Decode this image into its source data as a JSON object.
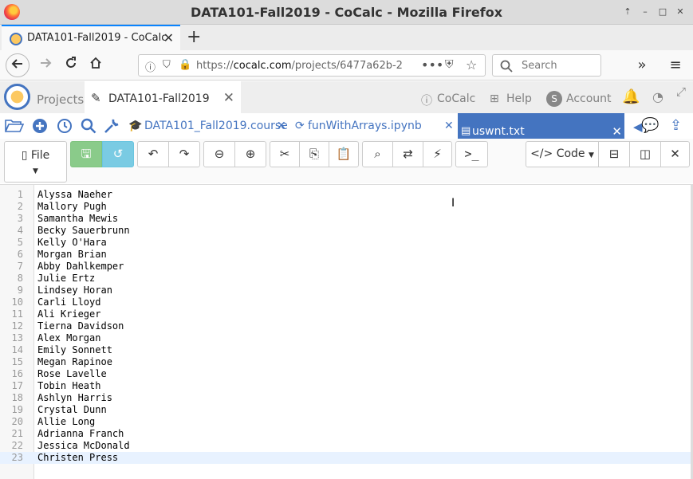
{
  "window": {
    "title": "DATA101-Fall2019 - CoCalc - Mozilla Firefox",
    "controls": [
      "⇡",
      "–",
      "□",
      "✕"
    ]
  },
  "browser": {
    "tab_title": "DATA101-Fall2019 - CoCalc",
    "new_tab": "+",
    "url_prefix": "https://",
    "url_domain": "cocalc.com",
    "url_path": "/projects/6477a62b-2",
    "search_placeholder": "Search"
  },
  "cocalc": {
    "projects_label": "Projects",
    "project_tab": "DATA101-Fall2019",
    "right_items": [
      "CoCalc",
      "Help",
      "Account"
    ],
    "account_initial": "S"
  },
  "files": {
    "tabs": [
      "DATA101_Fall2019.course",
      "funWithArrays.ipynb"
    ],
    "active_tab": "uswnt.txt"
  },
  "toolbar": {
    "file_label": "File",
    "code_label": "Code"
  },
  "editor": {
    "lines": [
      "Alyssa Naeher",
      "Mallory Pugh",
      "Samantha Mewis",
      "Becky Sauerbrunn",
      "Kelly O'Hara",
      "Morgan Brian",
      "Abby Dahlkemper",
      "Julie Ertz",
      "Lindsey Horan",
      "Carli Lloyd",
      "Ali Krieger",
      "Tierna Davidson",
      "Alex Morgan",
      "Emily Sonnett",
      "Megan Rapinoe",
      "Rose Lavelle",
      "Tobin Heath",
      "Ashlyn Harris",
      "Crystal Dunn",
      "Allie Long",
      "Adrianna Franch",
      "Jessica McDonald",
      "Christen Press"
    ],
    "line_numbers": [
      "1",
      "2",
      "3",
      "4",
      "5",
      "6",
      "7",
      "8",
      "9",
      "10",
      "11",
      "12",
      "13",
      "14",
      "15",
      "16",
      "17",
      "18",
      "19",
      "20",
      "21",
      "22",
      "23"
    ],
    "active_line": 23
  },
  "colors": {
    "accent": "#4474c0",
    "active_line": "#e8f2ff"
  }
}
